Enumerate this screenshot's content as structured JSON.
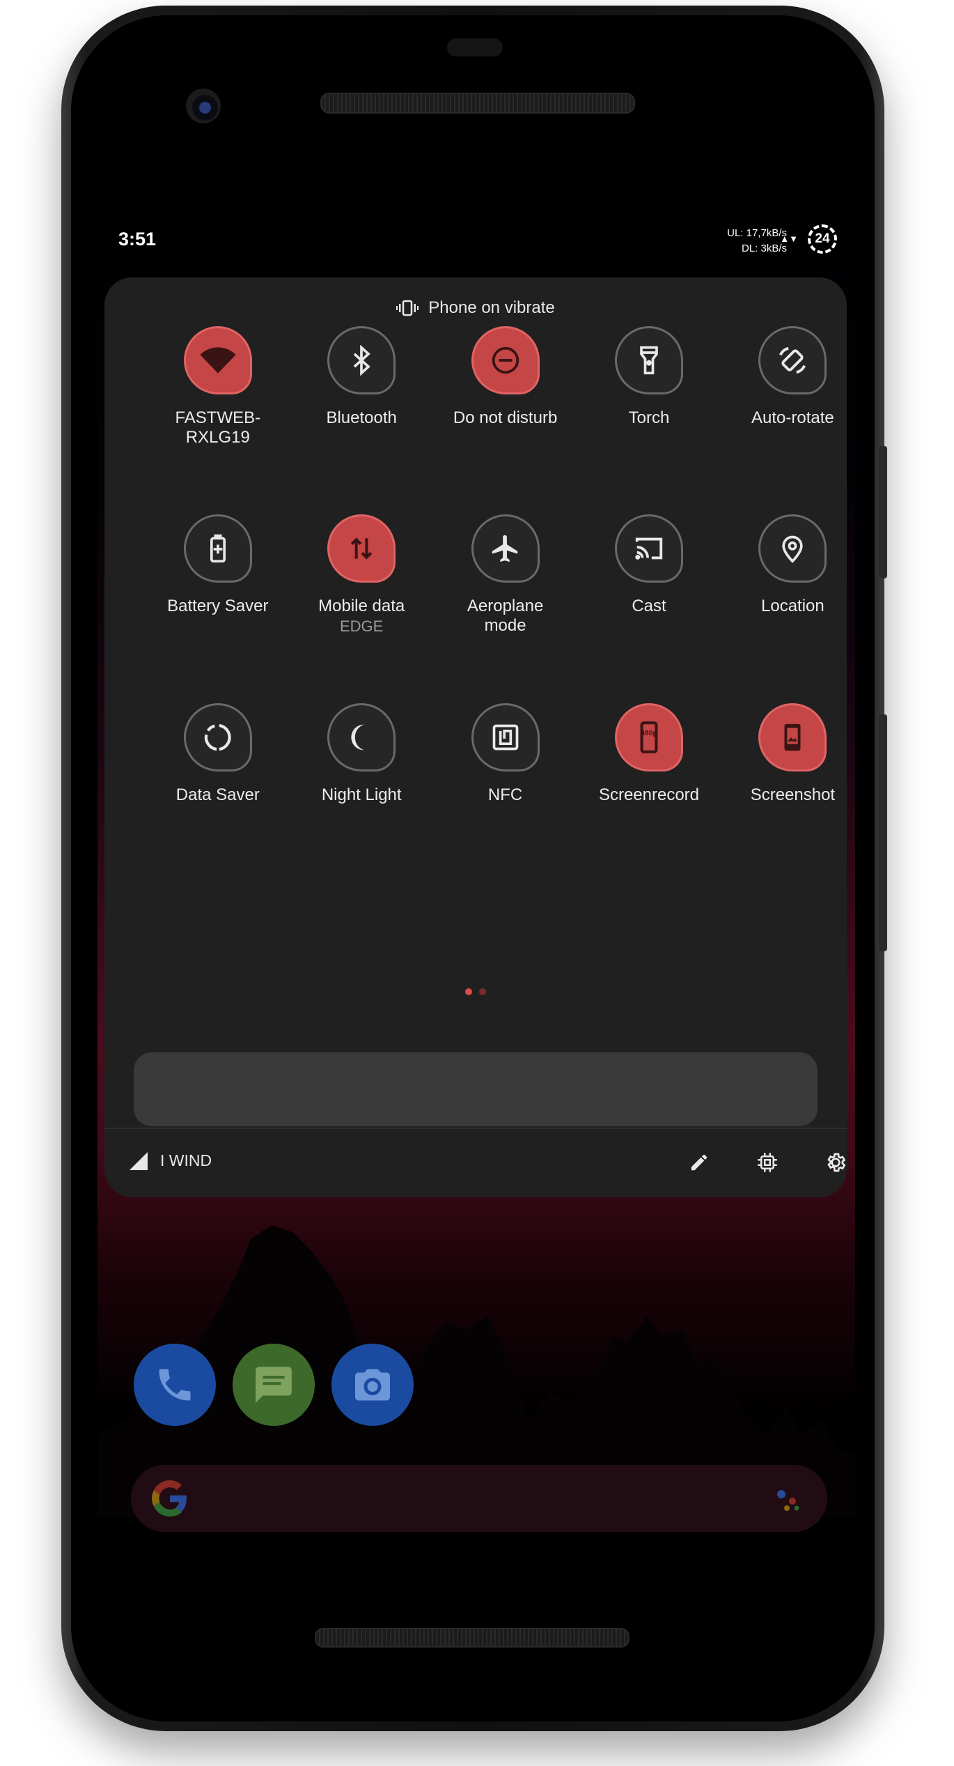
{
  "status_bar": {
    "time": "3:51",
    "upload": "UL: 17,7kB/s",
    "download": "DL: 3kB/s",
    "net_arrows": "▲▼",
    "battery_level": "24"
  },
  "header": {
    "ringer_label": "Phone on vibrate",
    "ringer_icon": "vibrate-icon"
  },
  "tiles": [
    {
      "label": "FASTWEB-\nRXLG19",
      "sub": "",
      "icon": "wifi-icon",
      "active": true
    },
    {
      "label": "Bluetooth",
      "sub": "",
      "icon": "bluetooth-icon",
      "active": false
    },
    {
      "label": "Do not disturb",
      "sub": "",
      "icon": "do-not-disturb-icon",
      "active": true
    },
    {
      "label": "Torch",
      "sub": "",
      "icon": "torch-icon",
      "active": false
    },
    {
      "label": "Auto-rotate",
      "sub": "",
      "icon": "auto-rotate-icon",
      "active": false
    },
    {
      "label": "Battery Saver",
      "sub": "",
      "icon": "battery-saver-icon",
      "active": false
    },
    {
      "label": "Mobile data",
      "sub": "EDGE",
      "icon": "mobile-data-icon",
      "active": true
    },
    {
      "label": "Aeroplane\nmode",
      "sub": "",
      "icon": "airplane-icon",
      "active": false
    },
    {
      "label": "Cast",
      "sub": "",
      "icon": "cast-icon",
      "active": false
    },
    {
      "label": "Location",
      "sub": "",
      "icon": "location-icon",
      "active": false
    },
    {
      "label": "Data Saver",
      "sub": "",
      "icon": "data-saver-icon",
      "active": false
    },
    {
      "label": "Night Light",
      "sub": "",
      "icon": "night-light-icon",
      "active": false
    },
    {
      "label": "NFC",
      "sub": "",
      "icon": "nfc-icon",
      "active": false
    },
    {
      "label": "Screenrecord",
      "sub": "",
      "icon": "screenrecord-icon",
      "active": true,
      "badge": "480p"
    },
    {
      "label": "Screenshot",
      "sub": "",
      "icon": "screenshot-icon",
      "active": true
    }
  ],
  "pager": {
    "pages": 2,
    "current": 1
  },
  "footer": {
    "carrier": "I WIND",
    "icons": [
      "edit-icon",
      "cpu-icon",
      "settings-icon"
    ]
  },
  "dock": {
    "apps": [
      "phone-app-icon",
      "messages-app-icon",
      "camera-app-icon"
    ]
  },
  "colors": {
    "accent": "#c54646",
    "panel": "#202020",
    "tile_inactive": "#262626"
  }
}
